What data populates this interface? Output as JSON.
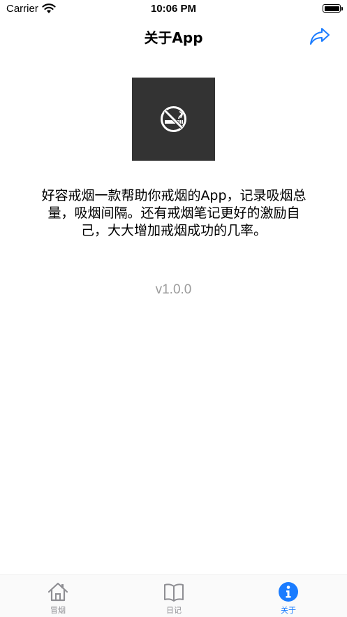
{
  "status_bar": {
    "carrier": "Carrier",
    "time": "10:06 PM"
  },
  "nav": {
    "title": "关于App",
    "share_icon": "share-arrow-icon",
    "accent_color": "#1a7cff"
  },
  "content": {
    "app_icon": "no-smoking-icon",
    "description": "好容戒烟一款帮助你戒烟的App，记录吸烟总量，吸烟间隔。还有戒烟笔记更好的激励自己，大大增加戒烟成功的几率。",
    "version": "v1.0.0"
  },
  "tab_bar": {
    "tabs": [
      {
        "label": "冒烟",
        "icon": "house-icon",
        "active": false
      },
      {
        "label": "日记",
        "icon": "book-icon",
        "active": false
      },
      {
        "label": "关于",
        "icon": "info-icon",
        "active": true
      }
    ],
    "active_color": "#1a7cff",
    "inactive_color": "#8e8e93"
  }
}
